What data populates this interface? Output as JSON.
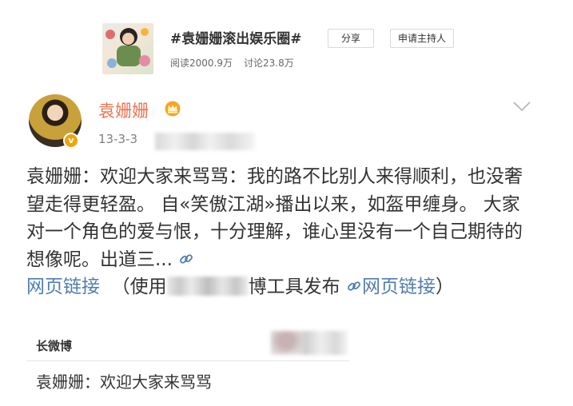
{
  "topic": {
    "title": "#袁姗姗滚出娱乐圈#",
    "share_label": "分享",
    "host_apply_label": "申请主持人",
    "read_count": "阅读2000.9万",
    "discuss_count": "讨论23.8万"
  },
  "post": {
    "username": "袁姗姗",
    "time": "13-3-3",
    "text_main": "袁姗姗：欢迎大家来骂骂：我的路不比别人来得顺利，也没奢望走得更轻盈。 自«笑傲江湖»播出以来，如盔甲缠身。 大家对一个角色的爱与恨，十分理解，谁心里没有一个自己期待的想像呢。出道三...",
    "link_text_1": "网页链接",
    "source_prefix": "（使用",
    "source_suffix": "博工具发布",
    "link_text_2": "网页链接",
    "source_close": "）"
  },
  "long_weibo": {
    "label": "长微博",
    "body": "袁姗姗：欢迎大家来骂骂"
  },
  "colors": {
    "username": "#eb7350",
    "link": "#507daf",
    "verified_badge": "#f0a30a"
  },
  "icons": [
    "crown-icon",
    "verified-icon",
    "chevron-down-icon",
    "link-icon"
  ]
}
